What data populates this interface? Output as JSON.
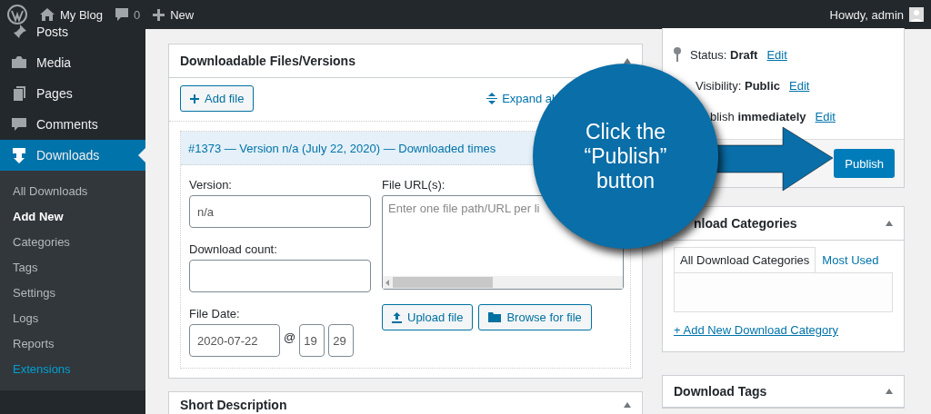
{
  "admin_bar": {
    "site": "My Blog",
    "comments": "0",
    "new": "New",
    "greeting": "Howdy, admin"
  },
  "sidebar": {
    "items": [
      {
        "label": "Posts",
        "selected": false
      },
      {
        "label": "Media",
        "selected": false
      },
      {
        "label": "Pages",
        "selected": false
      },
      {
        "label": "Comments",
        "selected": false
      },
      {
        "label": "Downloads",
        "selected": true
      }
    ],
    "submenu": [
      {
        "label": "All Downloads",
        "selected": false,
        "kind": "plain"
      },
      {
        "label": "Add New",
        "selected": true,
        "kind": "plain"
      },
      {
        "label": "Categories",
        "selected": false,
        "kind": "plain"
      },
      {
        "label": "Tags",
        "selected": false,
        "kind": "plain"
      },
      {
        "label": "Settings",
        "selected": false,
        "kind": "plain"
      },
      {
        "label": "Logs",
        "selected": false,
        "kind": "plain"
      },
      {
        "label": "Reports",
        "selected": false,
        "kind": "plain"
      },
      {
        "label": "Extensions",
        "selected": false,
        "kind": "promo"
      }
    ]
  },
  "files_box": {
    "title": "Downloadable Files/Versions",
    "add_button": "Add file",
    "expand_link": "Expand al",
    "file": {
      "header": "#1373 — Version n/a (July 22, 2020) — Downloaded times",
      "version_label": "Version:",
      "version_value": "n/a",
      "count_label": "Download count:",
      "date_label": "File Date:",
      "date": "2020-07-22",
      "at": "@",
      "hour": "19",
      "minute": "29",
      "urls_label": "File URL(s):",
      "urls_placeholder": "Enter one file path/URL per li",
      "upload_button": "Upload file",
      "browse_button": "Browse for file"
    }
  },
  "short_description": {
    "title": "Short Description"
  },
  "publish_box": {
    "status_label": "Status:",
    "status": "Draft",
    "visibility_label": "Visibility:",
    "visibility": "Public",
    "schedule_label": "blish",
    "schedule": "immediately",
    "edit_links": [
      "Edit",
      "Edit",
      "Edit"
    ],
    "button": "Publish"
  },
  "categories_box": {
    "title": "nload Categories",
    "tabs": [
      {
        "label": "All Download Categories",
        "selected": true
      },
      {
        "label": "Most Used",
        "selected": false
      }
    ],
    "add_link": "+ Add New Download Category"
  },
  "tags_box": {
    "title": "Download Tags"
  },
  "callout": {
    "lines": [
      "Click the",
      "“Publish”",
      "button"
    ]
  }
}
